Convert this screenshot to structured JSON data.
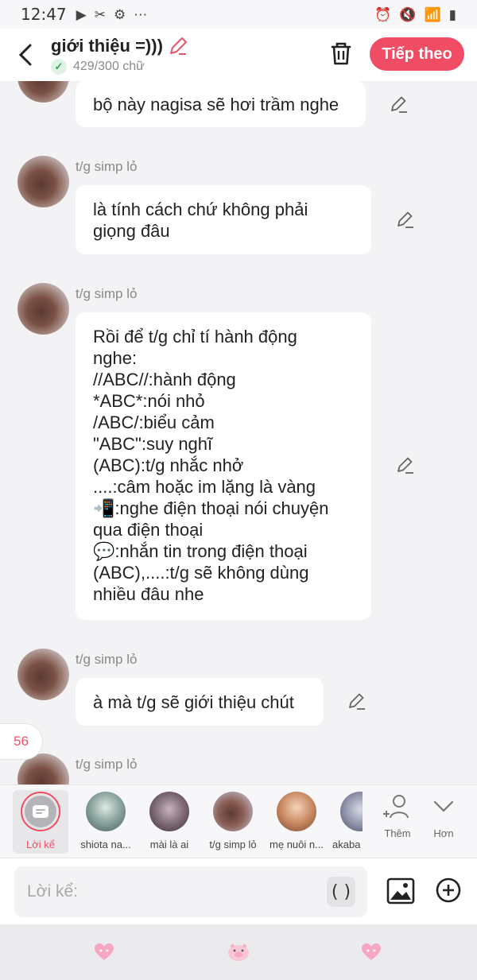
{
  "status_bar": {
    "time": "12:47"
  },
  "header": {
    "title": "giới thiệu =)))",
    "count": "429/300 chữ",
    "next_label": "Tiếp theo"
  },
  "messages": [
    {
      "sender": "",
      "lines": [
        "bộ này nagisa sẽ hơi trầm nghe"
      ]
    },
    {
      "sender": "t/g simp lỏ",
      "lines": [
        "là tính cách chứ không phải",
        "giọng đâu"
      ]
    },
    {
      "sender": "t/g simp lỏ",
      "lines": [
        "Rồi để t/g chỉ tí hành động",
        "nghe:",
        "//ABC//:hành động",
        "*ABC*:nói nhỏ",
        "/ABC/:biểu cảm",
        "\"ABC\":suy nghĩ",
        "(ABC):t/g nhắc nhở",
        "....:câm hoặc im lặng là vàng",
        "📲:nghe điện thoại nói chuyện",
        "qua điện thoại",
        "💬:nhắn tin trong điện thoại",
        "(ABC),....:t/g sẽ không dùng",
        "nhiều đâu nhe"
      ]
    },
    {
      "sender": "t/g simp lỏ",
      "lines": [
        "à mà t/g sẽ giới thiệu chút"
      ]
    },
    {
      "sender": "t/g simp lỏ",
      "lines": []
    }
  ],
  "badge": "56",
  "characters": [
    {
      "name": "Lời kể",
      "color": "#b4b4b8"
    },
    {
      "name": "shiota na...",
      "color": "#6f8a86"
    },
    {
      "name": "mài là ai",
      "color": "#7d6a74"
    },
    {
      "name": "t/g simp lỏ",
      "color": "#8a5e55"
    },
    {
      "name": "mẹ nuôi n...",
      "color": "#c98a62"
    },
    {
      "name": "akaba",
      "color": "#8b8fa6"
    }
  ],
  "tools": {
    "add_label": "Thêm",
    "more_label": "Hơn"
  },
  "input": {
    "placeholder": "Lời kể:",
    "paren": "( )"
  },
  "colors": {
    "accent": "#f04d64",
    "sticker": "#f6a7c4"
  }
}
